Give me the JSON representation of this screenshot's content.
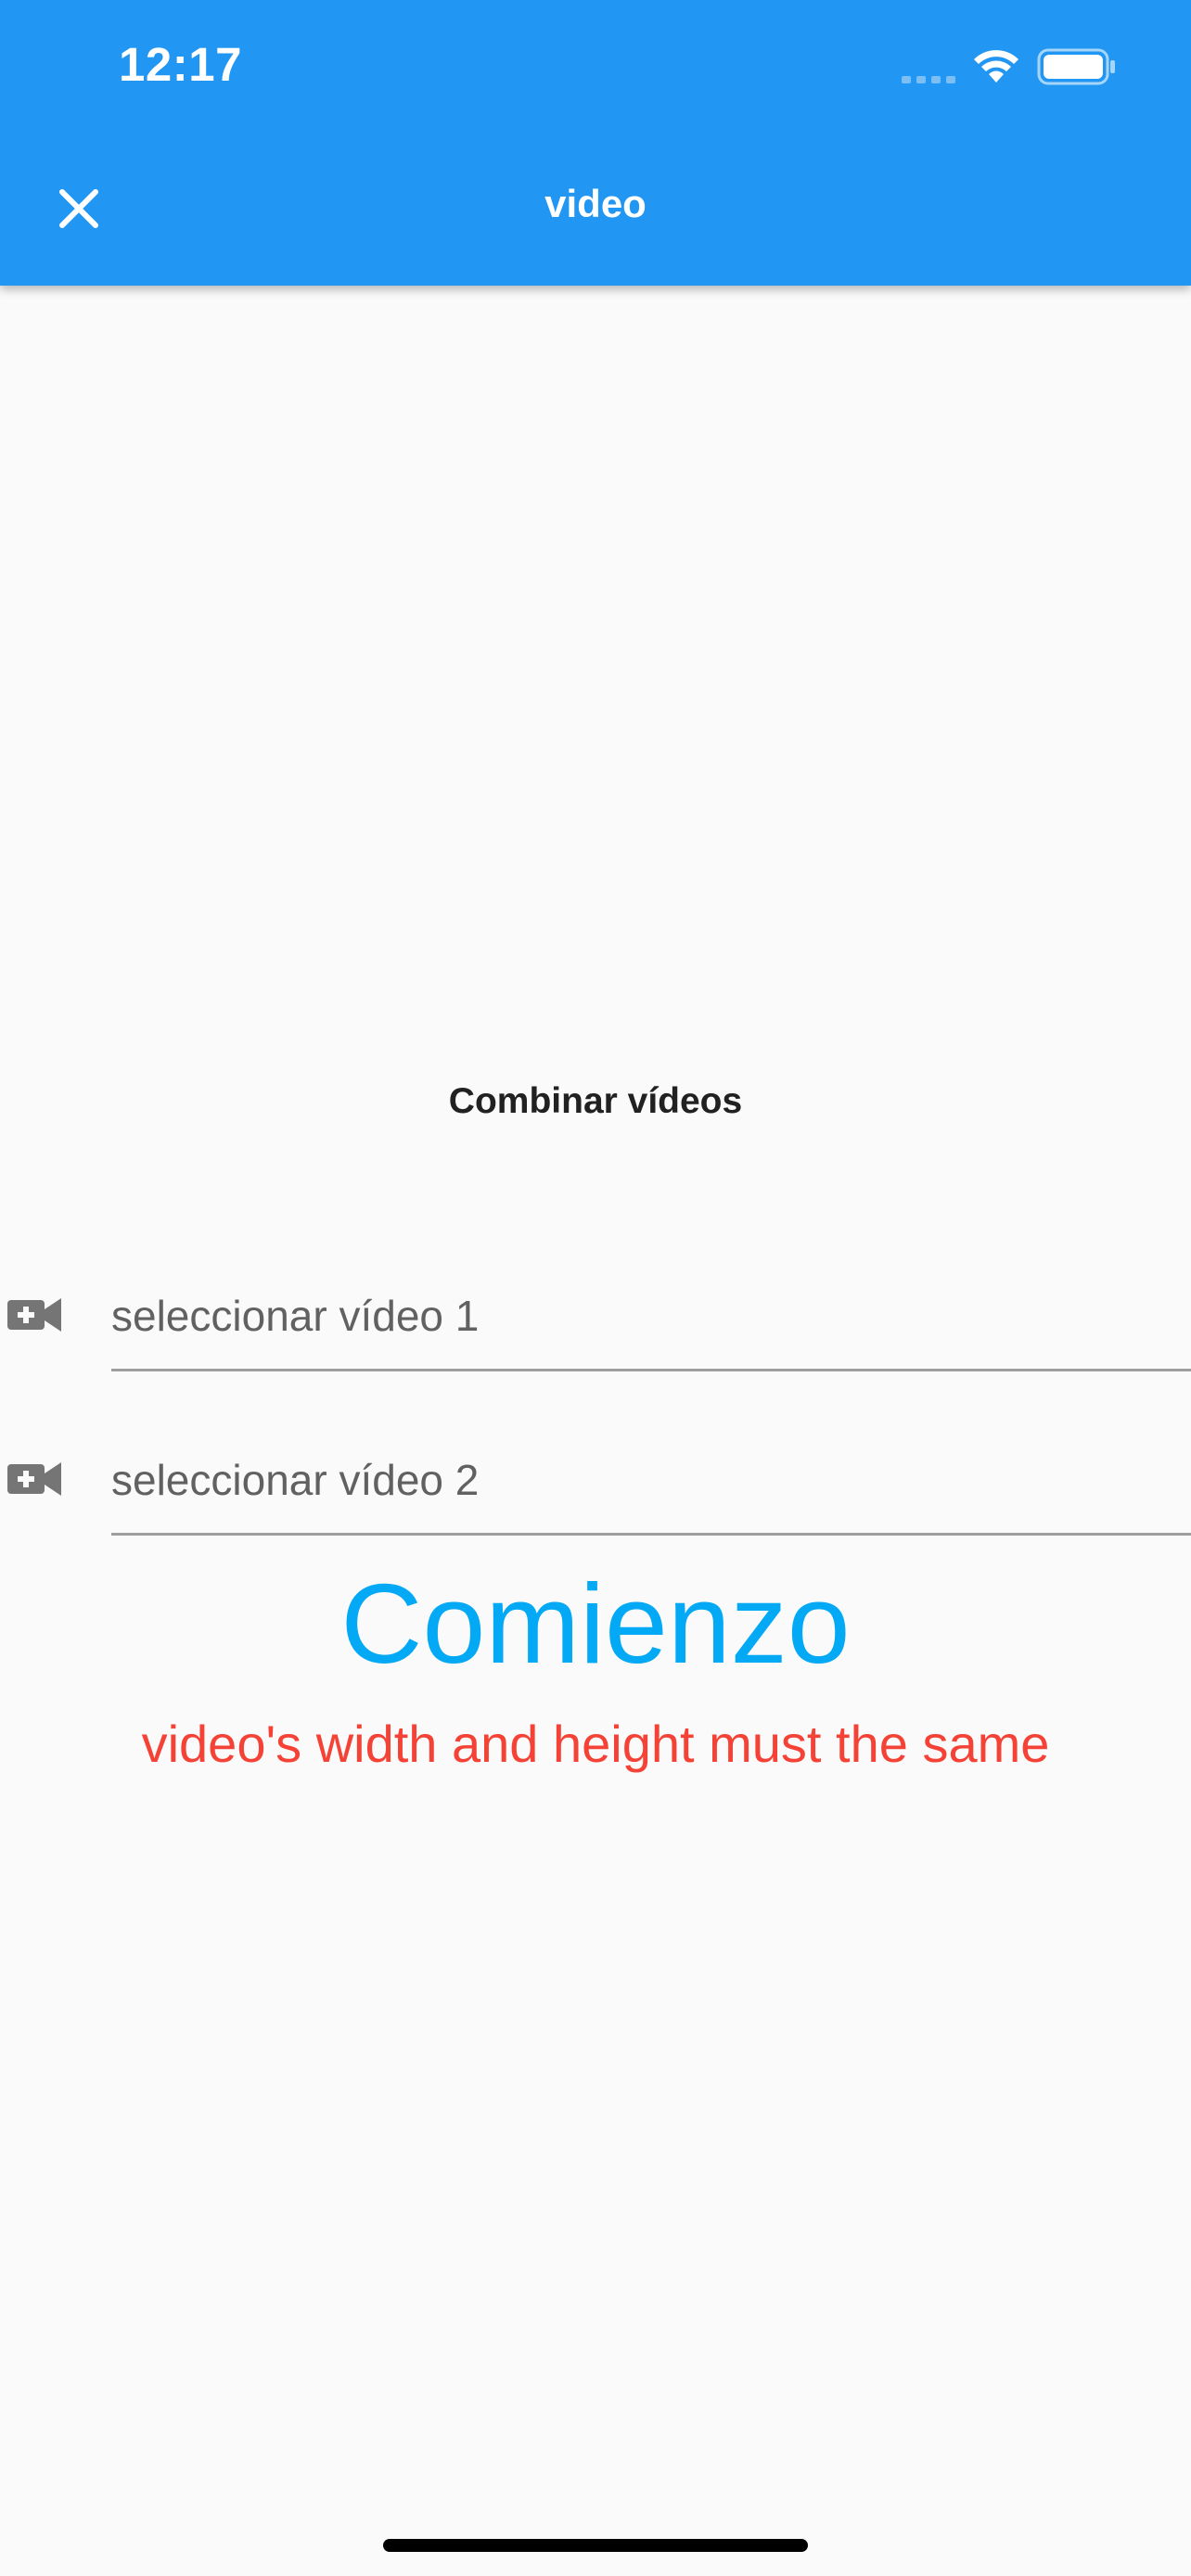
{
  "status_bar": {
    "time": "12:17"
  },
  "app_bar": {
    "title": "video",
    "close_icon": "close-icon"
  },
  "main": {
    "section_title": "Combinar vídeos",
    "video_fields": [
      {
        "icon": "video-camera-add-icon",
        "label": "seleccionar vídeo 1"
      },
      {
        "icon": "video-camera-add-icon",
        "label": "seleccionar vídeo 2"
      }
    ],
    "start_button_label": "Comienzo",
    "warning_text": "video's width and height must the same"
  },
  "colors": {
    "app_bar": "#2196f3",
    "background": "#fafafa",
    "start_button": "#03a9f4",
    "warning": "#f44336",
    "field_text": "#616161"
  }
}
